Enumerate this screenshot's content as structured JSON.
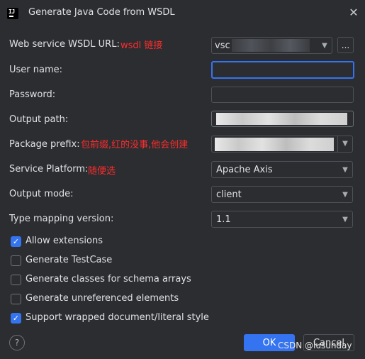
{
  "window": {
    "icon_text": "IJ",
    "title": "Generate Java Code from WSDL",
    "close_glyph": "✕"
  },
  "form": {
    "wsdl_url": {
      "label": "Web service WSDL URL:",
      "value": "vsc",
      "annotation": "wsdl 链接",
      "browse_label": "..."
    },
    "user_name": {
      "label": "User name:",
      "value": ""
    },
    "password": {
      "label": "Password:",
      "value": ""
    },
    "output_path": {
      "label": "Output path:",
      "value": ""
    },
    "package_prefix": {
      "label": "Package prefix:",
      "annotation": "包前缀,红的没事,他会创建"
    },
    "service_platform": {
      "label": "Service Platform:",
      "annotation": "随便选",
      "value": "Apache Axis"
    },
    "output_mode": {
      "label": "Output mode:",
      "value": "client"
    },
    "type_mapping_version": {
      "label": "Type mapping version:",
      "value": "1.1"
    }
  },
  "options": [
    {
      "label": "Allow extensions",
      "checked": true
    },
    {
      "label": "Generate TestCase",
      "checked": false
    },
    {
      "label": "Generate classes for schema arrays",
      "checked": false
    },
    {
      "label": "Generate unreferenced elements",
      "checked": false
    },
    {
      "label": "Support wrapped document/literal style",
      "checked": true
    }
  ],
  "footer": {
    "help_glyph": "?",
    "ok_label": "OK",
    "cancel_label": "Cancel",
    "watermark": "CSDN @lusunday"
  },
  "icons": {
    "dropdown": "chevron-down-icon",
    "check": "checkmark-icon",
    "help": "question-icon",
    "close": "close-icon"
  },
  "colors": {
    "background": "#2b2d30",
    "accent": "#3574f0",
    "annotation": "#ff2d2d",
    "text": "#dfe1e5"
  }
}
